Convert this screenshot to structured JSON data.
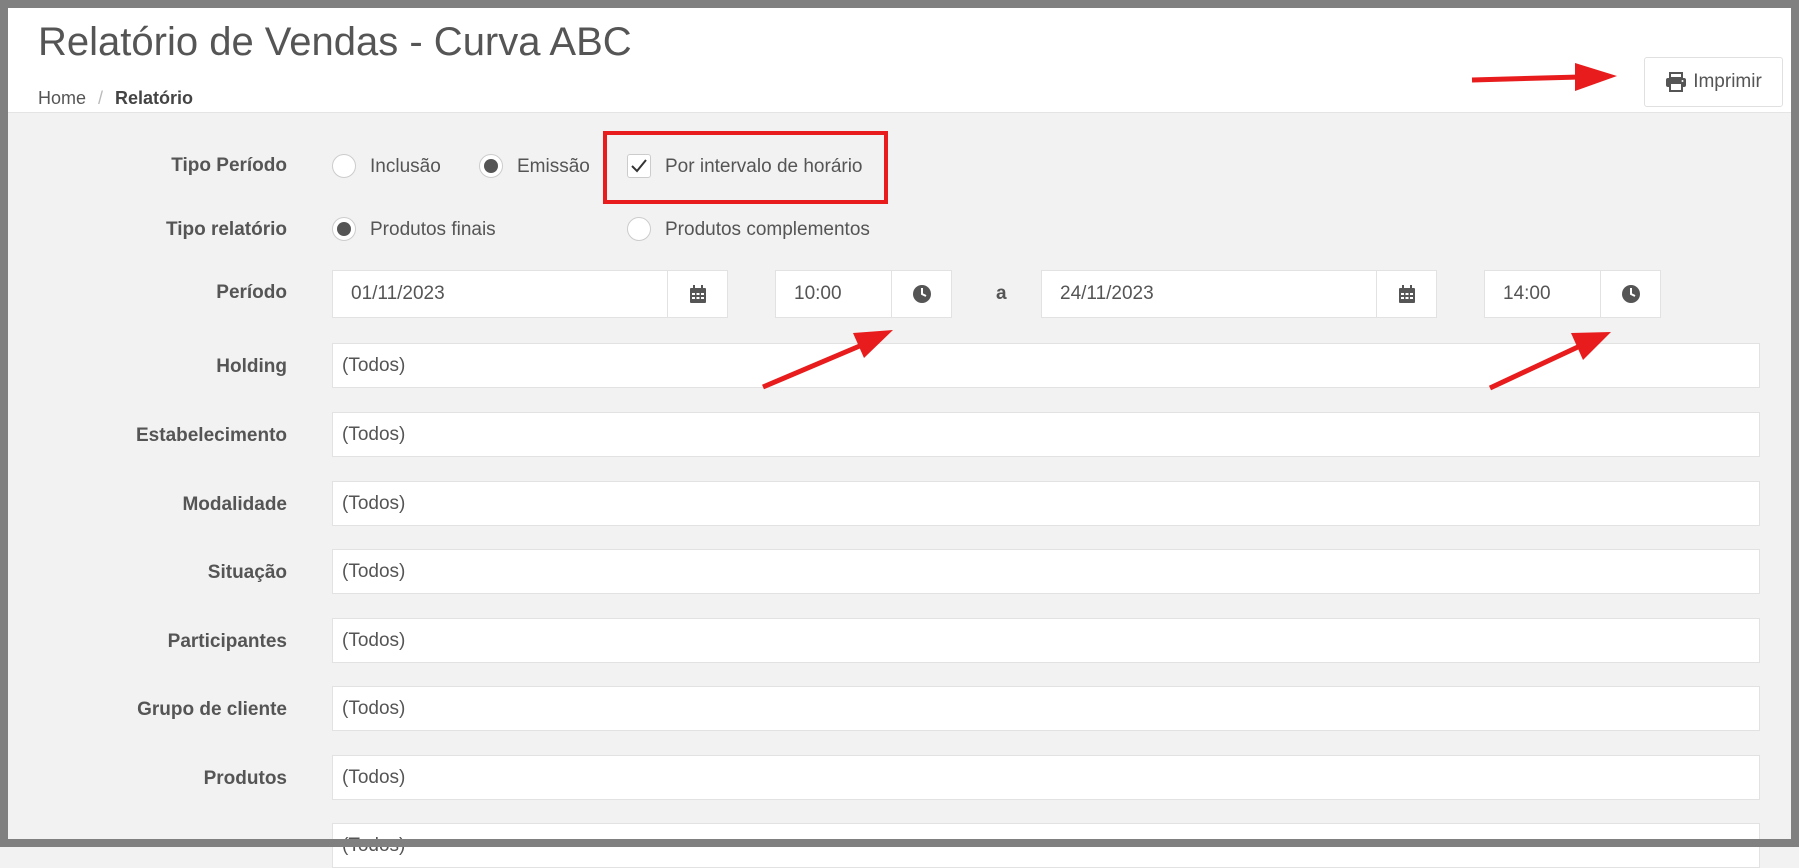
{
  "page": {
    "title": "Relatório de Vendas - Curva ABC",
    "breadcrumb": {
      "home": "Home",
      "separator": "/",
      "current": "Relatório"
    },
    "print_button": {
      "label": "Imprimir",
      "icon": "printer-icon"
    }
  },
  "form": {
    "tipo_periodo": {
      "label": "Tipo Período",
      "options": [
        {
          "label": "Inclusão",
          "checked": false
        },
        {
          "label": "Emissão",
          "checked": true
        }
      ],
      "interval_checkbox": {
        "label": "Por intervalo de horário",
        "checked": true
      }
    },
    "tipo_relatorio": {
      "label": "Tipo relatório",
      "options": [
        {
          "label": "Produtos finais",
          "checked": true
        },
        {
          "label": "Produtos complementos",
          "checked": false
        }
      ]
    },
    "periodo": {
      "label": "Período",
      "start_date": "01/11/2023",
      "start_time": "10:00",
      "separator": "a",
      "end_date": "24/11/2023",
      "end_time": "14:00"
    },
    "filters": [
      {
        "label": "Holding",
        "value": "(Todos)"
      },
      {
        "label": "Estabelecimento",
        "value": "(Todos)"
      },
      {
        "label": "Modalidade",
        "value": "(Todos)"
      },
      {
        "label": "Situação",
        "value": "(Todos)"
      },
      {
        "label": "Participantes",
        "value": "(Todos)"
      },
      {
        "label": "Grupo de cliente",
        "value": "(Todos)"
      },
      {
        "label": "Produtos",
        "value": "(Todos)"
      },
      {
        "label": "",
        "value": "(Todos)"
      }
    ]
  },
  "colors": {
    "annotation_red": "#e81c1c",
    "radio_fill": "#555555",
    "frame": "#808080"
  }
}
